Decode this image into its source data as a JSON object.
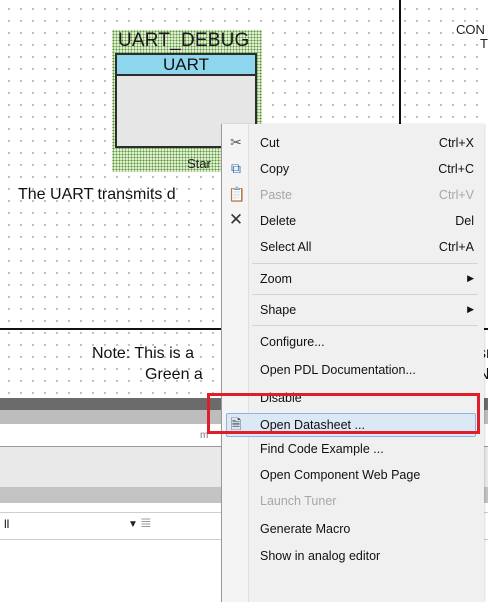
{
  "canvas": {
    "component_name": "UART_DEBUG",
    "component_type": "UART",
    "component_pin": "Star",
    "top_right_label": "CON",
    "top_right_label2": "T",
    "description": "The UART transmits d",
    "note_line1": "Note: This is a",
    "note_line2": "Green a",
    "note_right1": "sr",
    "note_right2": "N"
  },
  "bottom_panel": {
    "strip_marker": "m",
    "dropdown_value": "ll"
  },
  "context_menu": {
    "items": [
      {
        "label": "Cut",
        "shortcut": "Ctrl+X",
        "icon": "scissors-icon",
        "enabled": true
      },
      {
        "label": "Copy",
        "shortcut": "Ctrl+C",
        "icon": "copy-icon",
        "enabled": true
      },
      {
        "label": "Paste",
        "shortcut": "Ctrl+V",
        "icon": "paste-icon",
        "enabled": false
      },
      {
        "label": "Delete",
        "shortcut": "Del",
        "icon": "delete-x-icon",
        "enabled": true
      },
      {
        "label": "Select All",
        "shortcut": "Ctrl+A",
        "enabled": true
      },
      {
        "label": "Zoom",
        "submenu": true,
        "enabled": true
      },
      {
        "label": "Shape",
        "submenu": true,
        "enabled": true
      },
      {
        "label": "Configure...",
        "enabled": true
      },
      {
        "label": "Open PDL Documentation...",
        "enabled": true
      },
      {
        "label": "Disable",
        "enabled": true
      },
      {
        "label": "Open Datasheet ...",
        "icon": "datasheet-icon",
        "enabled": true,
        "highlighted": true
      },
      {
        "label": "Find Code Example ...",
        "enabled": true
      },
      {
        "label": "Open Component Web Page",
        "enabled": true
      },
      {
        "label": "Launch Tuner",
        "enabled": false
      },
      {
        "label": "Generate Macro",
        "enabled": true
      },
      {
        "label": "Show in analog editor",
        "enabled": true
      }
    ]
  },
  "colors": {
    "highlight_border": "#e01d2a",
    "component_header": "#8ed6ee",
    "hover_background": "#dbe8f6"
  }
}
